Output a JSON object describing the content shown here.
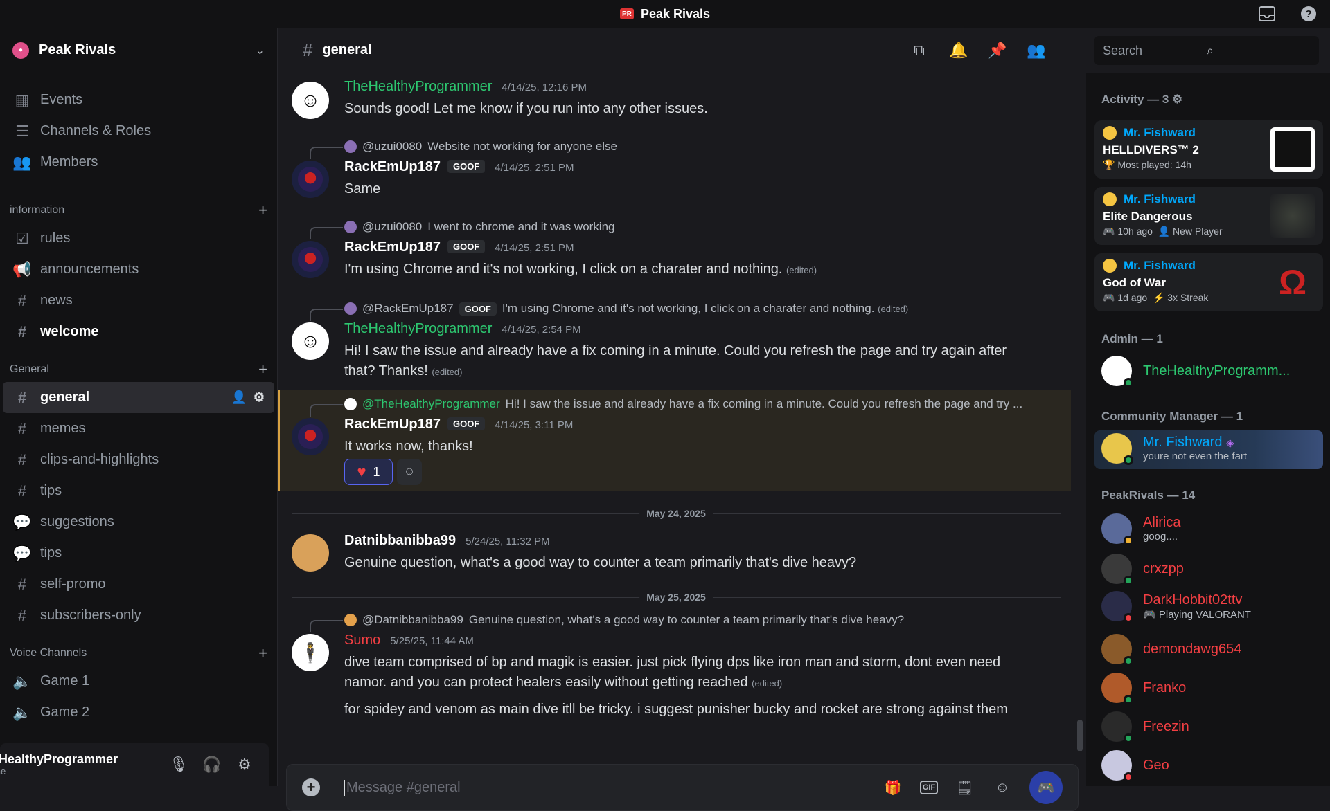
{
  "window": {
    "title": "Peak Rivals",
    "badge": "PR"
  },
  "sidebar": {
    "server_name": "Peak Rivals",
    "top_nav": [
      {
        "label": "Events",
        "icon": "calendar-icon"
      },
      {
        "label": "Channels & Roles",
        "icon": "list-icon"
      },
      {
        "label": "Members",
        "icon": "members-icon"
      }
    ],
    "categories": {
      "information": "information",
      "general": "General",
      "voice": "Voice Channels"
    },
    "info_channels": [
      {
        "label": "rules",
        "icon": "rules-icon"
      },
      {
        "label": "announcements",
        "icon": "megaphone-icon"
      },
      {
        "label": "news",
        "icon": "hash-icon"
      },
      {
        "label": "welcome",
        "icon": "hash-icon"
      }
    ],
    "general_channels": [
      {
        "label": "general",
        "icon": "hash-icon"
      },
      {
        "label": "memes",
        "icon": "hash-icon"
      },
      {
        "label": "clips-and-highlights",
        "icon": "hash-icon"
      },
      {
        "label": "tips",
        "icon": "hash-icon"
      },
      {
        "label": "suggestions",
        "icon": "forum-icon"
      },
      {
        "label": "tips",
        "icon": "forum-icon"
      },
      {
        "label": "self-promo",
        "icon": "hash-icon"
      },
      {
        "label": "subscribers-only",
        "icon": "hash-lock-icon"
      }
    ],
    "voice_channels": [
      {
        "label": "Game 1",
        "icon": "speaker-icon"
      },
      {
        "label": "Game 2",
        "icon": "speaker-icon"
      }
    ],
    "user": {
      "name": "eHealthyProgrammer",
      "status": "line"
    }
  },
  "channel": {
    "name": "general",
    "search_placeholder": "Search",
    "composer_placeholder": "Message #general"
  },
  "messages": [
    {
      "author": "TheHealthyProgrammer",
      "time": "4/14/25, 12:16 PM",
      "text": "Sounds good! Let me know if you run into any other issues."
    },
    {
      "reply_to": "@uzui0080",
      "reply_text": "Website not working for anyone else",
      "author": "RackEmUp187",
      "tag": "GOOF",
      "time": "4/14/25, 2:51 PM",
      "text": "Same"
    },
    {
      "reply_to": "@uzui0080",
      "reply_text": "I went to chrome and it was working",
      "author": "RackEmUp187",
      "tag": "GOOF",
      "time": "4/14/25, 2:51 PM",
      "text": "I'm using Chrome and it's not working, I click on a charater and nothing.",
      "edited": "(edited)"
    },
    {
      "reply_to": "@RackEmUp187",
      "reply_tag": "GOOF",
      "reply_text": "I'm using Chrome and it's not working, I click on a charater and nothing.",
      "reply_edited": "(edited)",
      "author": "TheHealthyProgrammer",
      "time": "4/14/25, 2:54 PM",
      "text": "Hi! I saw the issue and already have a fix coming in a minute. Could you refresh the page and try again after that? Thanks!",
      "edited": "(edited)"
    },
    {
      "reply_to": "@TheHealthyProgrammer",
      "reply_text": "Hi! I saw the issue and already have a fix coming in a minute. Could you refresh the page and try ...",
      "author": "RackEmUp187",
      "tag": "GOOF",
      "time": "4/14/25, 3:11 PM",
      "text": "It works now, thanks!",
      "reaction_count": "1"
    },
    {
      "divider": "May 24, 2025"
    },
    {
      "author": "Datnibbanibba99",
      "time": "5/24/25, 11:32 PM",
      "text": "Genuine question, what's a good way to counter a team primarily that's dive heavy?"
    },
    {
      "divider": "May 25, 2025"
    },
    {
      "reply_to": "@Datnibbanibba99",
      "reply_text": "Genuine question, what's a good way to counter a team primarily that's dive heavy?",
      "author": "Sumo",
      "time": "5/25/25, 11:44 AM",
      "text": "dive team comprised of bp and magik is easier. just pick flying dps like iron man and storm, dont even need namor. and you can protect healers easily without getting reached",
      "edited": "(edited)",
      "text2": "for spidey and venom as main dive itll be tricky. i suggest punisher bucky and rocket are strong against them"
    }
  ],
  "members_panel": {
    "activity_title": "Activity — 3",
    "activities": [
      {
        "user": "Mr. Fishward",
        "game": "HELLDIVERS™ 2",
        "meta": "Most played: 14h"
      },
      {
        "user": "Mr. Fishward",
        "game": "Elite Dangerous",
        "meta": "10h ago",
        "meta2": "New Player"
      },
      {
        "user": "Mr. Fishward",
        "game": "God of War",
        "meta": "1d ago",
        "meta2": "3x Streak"
      }
    ],
    "admin_title": "Admin — 1",
    "admin": {
      "name": "TheHealthyProgramm..."
    },
    "cm_title": "Community Manager — 1",
    "cm": {
      "name": "Mr. Fishward",
      "sub": "youre not even the fart"
    },
    "pr_title": "PeakRivals — 14",
    "members": [
      {
        "name": "Alirica",
        "sub": "goog...."
      },
      {
        "name": "crxzpp",
        "sub": ""
      },
      {
        "name": "DarkHobbit02ttv",
        "sub": "Playing VALORANT"
      },
      {
        "name": "demondawg654",
        "sub": ""
      },
      {
        "name": "Franko",
        "sub": ""
      },
      {
        "name": "Freezin",
        "sub": ""
      },
      {
        "name": "Geo",
        "sub": ""
      }
    ]
  },
  "colors": {
    "accent": "#5865f2",
    "admin_green": "#2dc770",
    "member_red": "#f23f43",
    "cm_blue": "#00a8fc",
    "highlight_gold": "#d8a242"
  }
}
